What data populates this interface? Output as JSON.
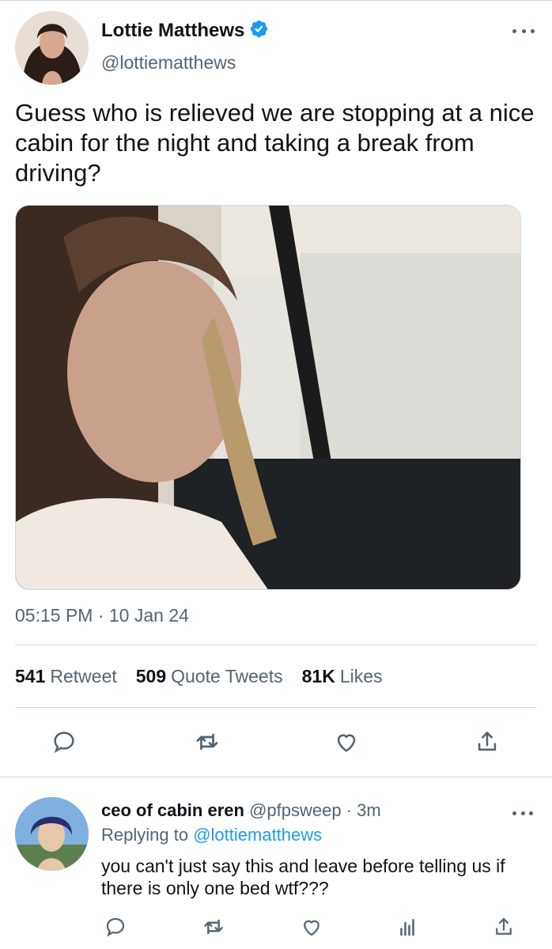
{
  "tweet": {
    "author_name": "Lottie Matthews",
    "author_handle": "@lottiematthews",
    "text": "Guess who is relieved we are stopping at a nice cabin for the night and taking a break from driving?",
    "timestamp": "05:15 PM · 10 Jan 24",
    "stats": {
      "retweets_count": "541",
      "retweets_label": "Retweet",
      "quotes_count": "509",
      "quotes_label": "Quote Tweets",
      "likes_count": "81K",
      "likes_label": "Likes"
    }
  },
  "reply": {
    "author_name": "ceo of cabin eren",
    "author_handle": "@pfpsweep",
    "time": "· 3m",
    "replying_prefix": "Replying to",
    "replying_to": "@lottiematthews",
    "text": "you can't just say this and leave before telling us if there is only one bed wtf???"
  },
  "icons": {
    "verified": "verified-badge-icon",
    "reply": "reply-icon",
    "retweet": "retweet-icon",
    "like": "like-icon",
    "share": "share-icon",
    "analytics": "analytics-icon",
    "more": "more-icon"
  },
  "colors": {
    "accent": "#1d9bf0",
    "text_primary": "#0f1419",
    "text_secondary": "#536471",
    "divider": "#cfd9de"
  }
}
